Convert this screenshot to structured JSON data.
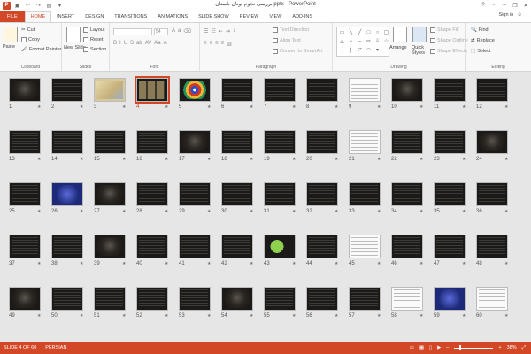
{
  "title_bar": {
    "title": "بررسی نجوم یونان باستان.pptx - PowerPoint",
    "controls": [
      "?",
      "▫",
      "–",
      "❐",
      "✕"
    ]
  },
  "tabs": [
    "FILE",
    "HOME",
    "INSERT",
    "DESIGN",
    "TRANSITIONS",
    "ANIMATIONS",
    "SLIDE SHOW",
    "REVIEW",
    "VIEW",
    "ADD-INS"
  ],
  "active_tab": "HOME",
  "signin": "Sign in",
  "ribbon": {
    "clipboard": {
      "label": "Clipboard",
      "paste": "Paste",
      "cut": "Cut",
      "copy": "Copy",
      "format_painter": "Format Painter"
    },
    "slides": {
      "label": "Slides",
      "new_slide": "New Slide",
      "layout": "Layout",
      "reset": "Reset",
      "section": "Section"
    },
    "font": {
      "label": "Font",
      "size": "54"
    },
    "paragraph": {
      "label": "Paragraph",
      "text_direction": "Text Direction",
      "align_text": "Align Text",
      "convert": "Convert to SmartArt"
    },
    "drawing": {
      "label": "Drawing",
      "arrange": "Arrange",
      "quick_styles": "Quick Styles",
      "shape_fill": "Shape Fill",
      "shape_outline": "Shape Outline",
      "shape_effects": "Shape Effects"
    },
    "editing": {
      "label": "Editing",
      "find": "Find",
      "replace": "Replace",
      "select": "Select"
    }
  },
  "slides": [
    {
      "n": "1",
      "t": "dark"
    },
    {
      "n": "2",
      "t": "text"
    },
    {
      "n": "3",
      "t": "map"
    },
    {
      "n": "4",
      "t": "grid",
      "selected": true
    },
    {
      "n": "5",
      "t": "wheel"
    },
    {
      "n": "6",
      "t": "text"
    },
    {
      "n": "7",
      "t": "text"
    },
    {
      "n": "8",
      "t": "text"
    },
    {
      "n": "9",
      "t": "white"
    },
    {
      "n": "10",
      "t": "dark"
    },
    {
      "n": "11",
      "t": "text"
    },
    {
      "n": "12",
      "t": "text"
    },
    {
      "n": "13",
      "t": "text"
    },
    {
      "n": "14",
      "t": "text"
    },
    {
      "n": "15",
      "t": "text"
    },
    {
      "n": "16",
      "t": "text"
    },
    {
      "n": "17",
      "t": "dark"
    },
    {
      "n": "18",
      "t": "text"
    },
    {
      "n": "19",
      "t": "text"
    },
    {
      "n": "20",
      "t": "text"
    },
    {
      "n": "21",
      "t": "white"
    },
    {
      "n": "22",
      "t": "text"
    },
    {
      "n": "23",
      "t": "text"
    },
    {
      "n": "24",
      "t": "dark"
    },
    {
      "n": "25",
      "t": "text"
    },
    {
      "n": "26",
      "t": "blue"
    },
    {
      "n": "27",
      "t": "dark"
    },
    {
      "n": "28",
      "t": "text"
    },
    {
      "n": "29",
      "t": "text"
    },
    {
      "n": "30",
      "t": "text"
    },
    {
      "n": "31",
      "t": "text"
    },
    {
      "n": "32",
      "t": "text"
    },
    {
      "n": "33",
      "t": "text"
    },
    {
      "n": "34",
      "t": "text"
    },
    {
      "n": "35",
      "t": "text"
    },
    {
      "n": "36",
      "t": "text"
    },
    {
      "n": "37",
      "t": "text"
    },
    {
      "n": "38",
      "t": "text"
    },
    {
      "n": "39",
      "t": "dark"
    },
    {
      "n": "40",
      "t": "text"
    },
    {
      "n": "41",
      "t": "text"
    },
    {
      "n": "42",
      "t": "text"
    },
    {
      "n": "43",
      "t": "green"
    },
    {
      "n": "44",
      "t": "text"
    },
    {
      "n": "45",
      "t": "white"
    },
    {
      "n": "46",
      "t": "text"
    },
    {
      "n": "47",
      "t": "text"
    },
    {
      "n": "48",
      "t": "text"
    },
    {
      "n": "49",
      "t": "dark"
    },
    {
      "n": "50",
      "t": "text"
    },
    {
      "n": "51",
      "t": "text"
    },
    {
      "n": "52",
      "t": "text"
    },
    {
      "n": "53",
      "t": "text"
    },
    {
      "n": "54",
      "t": "dark"
    },
    {
      "n": "55",
      "t": "text"
    },
    {
      "n": "56",
      "t": "text"
    },
    {
      "n": "57",
      "t": "text"
    },
    {
      "n": "58",
      "t": "white"
    },
    {
      "n": "59",
      "t": "blue"
    },
    {
      "n": "60",
      "t": "white"
    }
  ],
  "status": {
    "slide_info": "SLIDE 4 OF 60",
    "language": "PERSIAN",
    "zoom": "38%",
    "zoom_fraction": 0.38
  },
  "colors": {
    "accent": "#d24726",
    "sorter_bg": "#e6e6e6"
  }
}
